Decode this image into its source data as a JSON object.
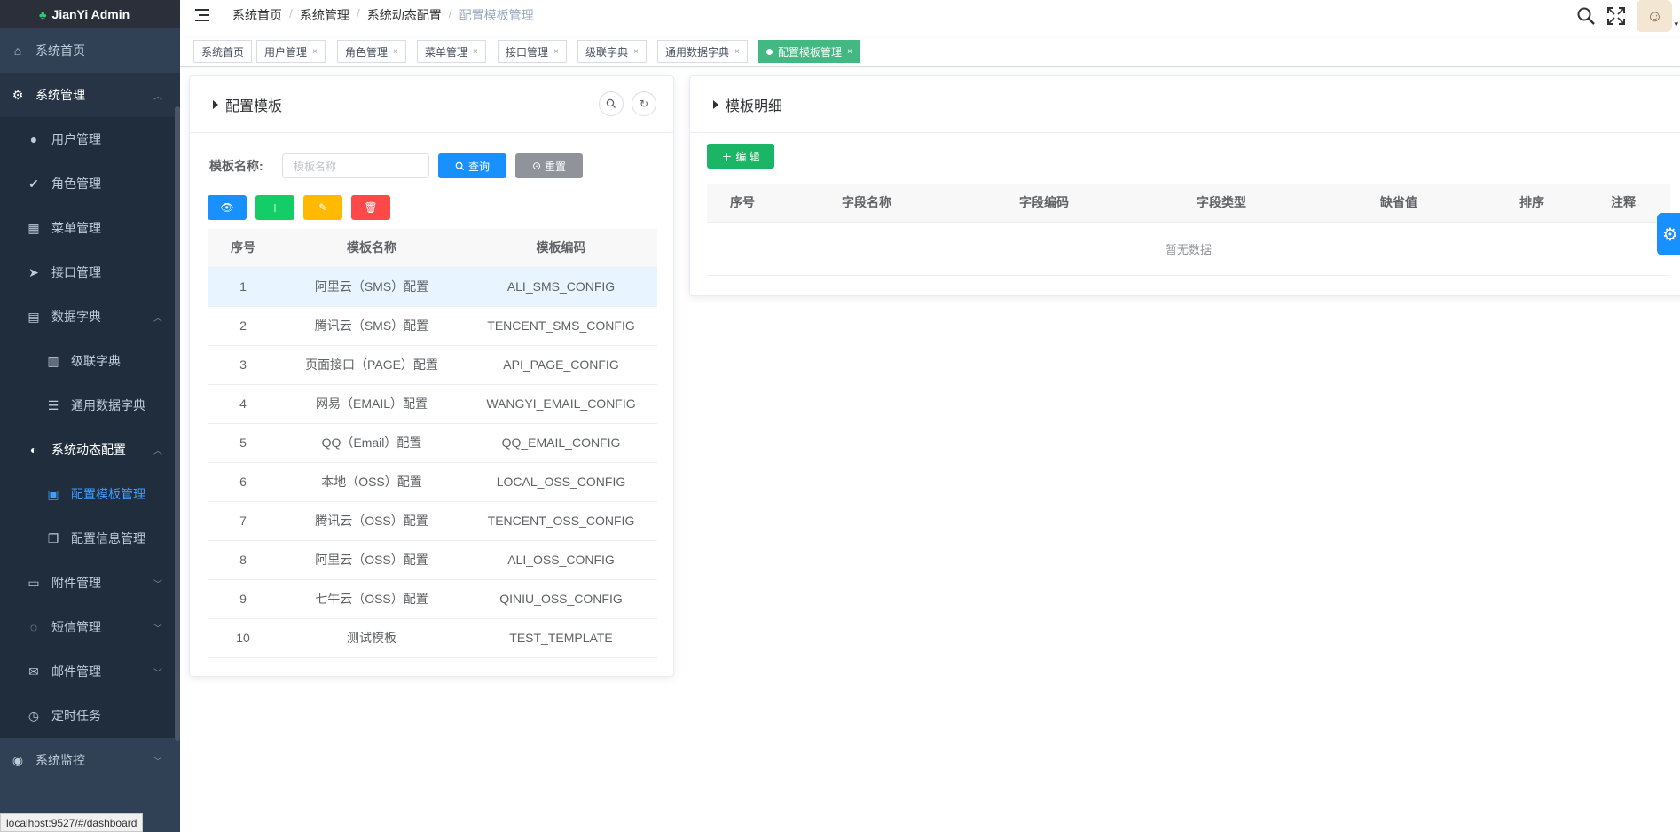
{
  "app": {
    "title": "JianYi Admin"
  },
  "sidebar": {
    "items": [
      {
        "label": "系统首页",
        "icon": "home-icon"
      },
      {
        "label": "系统管理",
        "icon": "gear-icon"
      },
      {
        "label": "用户管理",
        "icon": "user-icon"
      },
      {
        "label": "角色管理",
        "icon": "check-circle-icon"
      },
      {
        "label": "菜单管理",
        "icon": "grid-icon"
      },
      {
        "label": "接口管理",
        "icon": "send-icon"
      },
      {
        "label": "数据字典",
        "icon": "clipboard-icon"
      },
      {
        "label": "级联字典",
        "icon": "books-icon"
      },
      {
        "label": "通用数据字典",
        "icon": "sliders-icon"
      },
      {
        "label": "系统动态配置",
        "icon": "toggle-icon"
      },
      {
        "label": "配置模板管理",
        "icon": "template-icon"
      },
      {
        "label": "配置信息管理",
        "icon": "copy-icon"
      },
      {
        "label": "附件管理",
        "icon": "folder-icon"
      },
      {
        "label": "短信管理",
        "icon": "chat-icon"
      },
      {
        "label": "邮件管理",
        "icon": "mail-icon"
      },
      {
        "label": "定时任务",
        "icon": "clock-icon"
      },
      {
        "label": "系统监控",
        "icon": "monitor-icon"
      }
    ]
  },
  "breadcrumb": {
    "items": [
      "系统首页",
      "系统管理",
      "系统动态配置",
      "配置模板管理"
    ]
  },
  "tags": [
    "系统首页",
    "用户管理",
    "角色管理",
    "菜单管理",
    "接口管理",
    "级联字典",
    "通用数据字典",
    "配置模板管理"
  ],
  "left_panel": {
    "title": "配置模板",
    "search_label": "模板名称:",
    "search_placeholder": "模板名称",
    "query_label": "查询",
    "reset_label": "重置",
    "columns": [
      "序号",
      "模板名称",
      "模板编码"
    ],
    "rows": [
      [
        "1",
        "阿里云（SMS）配置",
        "ALI_SMS_CONFIG"
      ],
      [
        "2",
        "腾讯云（SMS）配置",
        "TENCENT_SMS_CONFIG"
      ],
      [
        "3",
        "页面接口（PAGE）配置",
        "API_PAGE_CONFIG"
      ],
      [
        "4",
        "网易（EMAIL）配置",
        "WANGYI_EMAIL_CONFIG"
      ],
      [
        "5",
        "QQ（Email）配置",
        "QQ_EMAIL_CONFIG"
      ],
      [
        "6",
        "本地（OSS）配置",
        "LOCAL_OSS_CONFIG"
      ],
      [
        "7",
        "腾讯云（OSS）配置",
        "TENCENT_OSS_CONFIG"
      ],
      [
        "8",
        "阿里云（OSS）配置",
        "ALI_OSS_CONFIG"
      ],
      [
        "9",
        "七牛云（OSS）配置",
        "QINIU_OSS_CONFIG"
      ],
      [
        "10",
        "测试模板",
        "TEST_TEMPLATE"
      ]
    ]
  },
  "right_panel": {
    "title": "模板明细",
    "edit_label": "编 辑",
    "columns": [
      "序号",
      "字段名称",
      "字段编码",
      "字段类型",
      "缺省值",
      "排序",
      "注释"
    ],
    "empty_text": "暂无数据"
  },
  "status_bar": {
    "url": "localhost:9527/#/dashboard"
  }
}
